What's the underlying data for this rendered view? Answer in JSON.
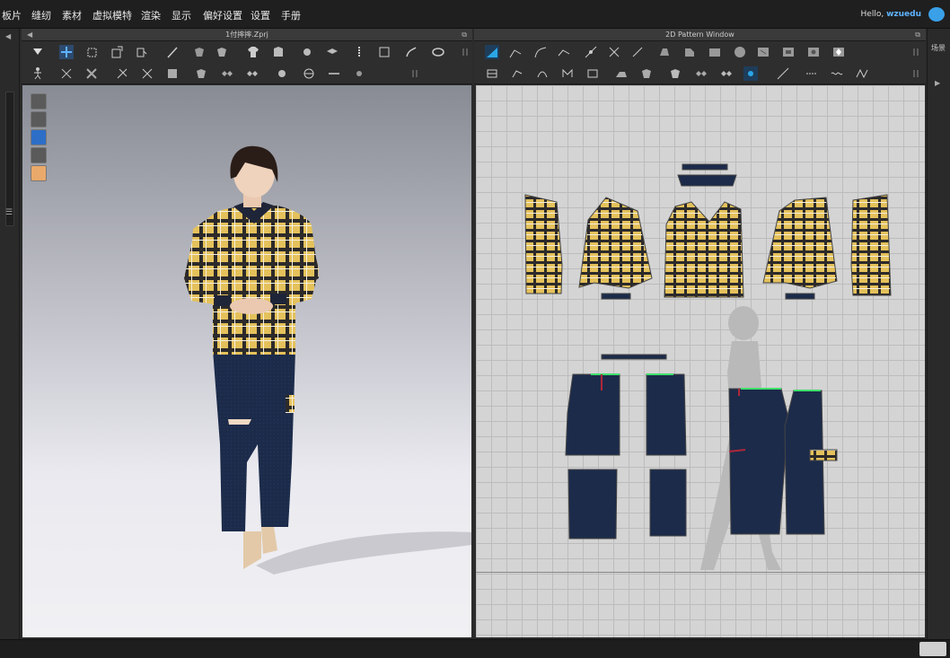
{
  "menu": {
    "items": [
      "板片",
      "缝纫",
      "素材",
      "虚拟模特",
      "渲染",
      "显示",
      "偏好设置",
      "设置",
      "手册"
    ],
    "hello_prefix": "Hello,",
    "user": "wzuedu"
  },
  "left_panel": {
    "title": "1付摔摔.Zprj"
  },
  "right_panel": {
    "title": "2D Pattern Window"
  },
  "right_strip": {
    "label": "场景"
  },
  "colors": {
    "plaid_yellow": "#e4c15b",
    "plaid_dark": "#2c2a2a",
    "denim": "#1c2b4a",
    "accent": "#3aa0e8"
  }
}
